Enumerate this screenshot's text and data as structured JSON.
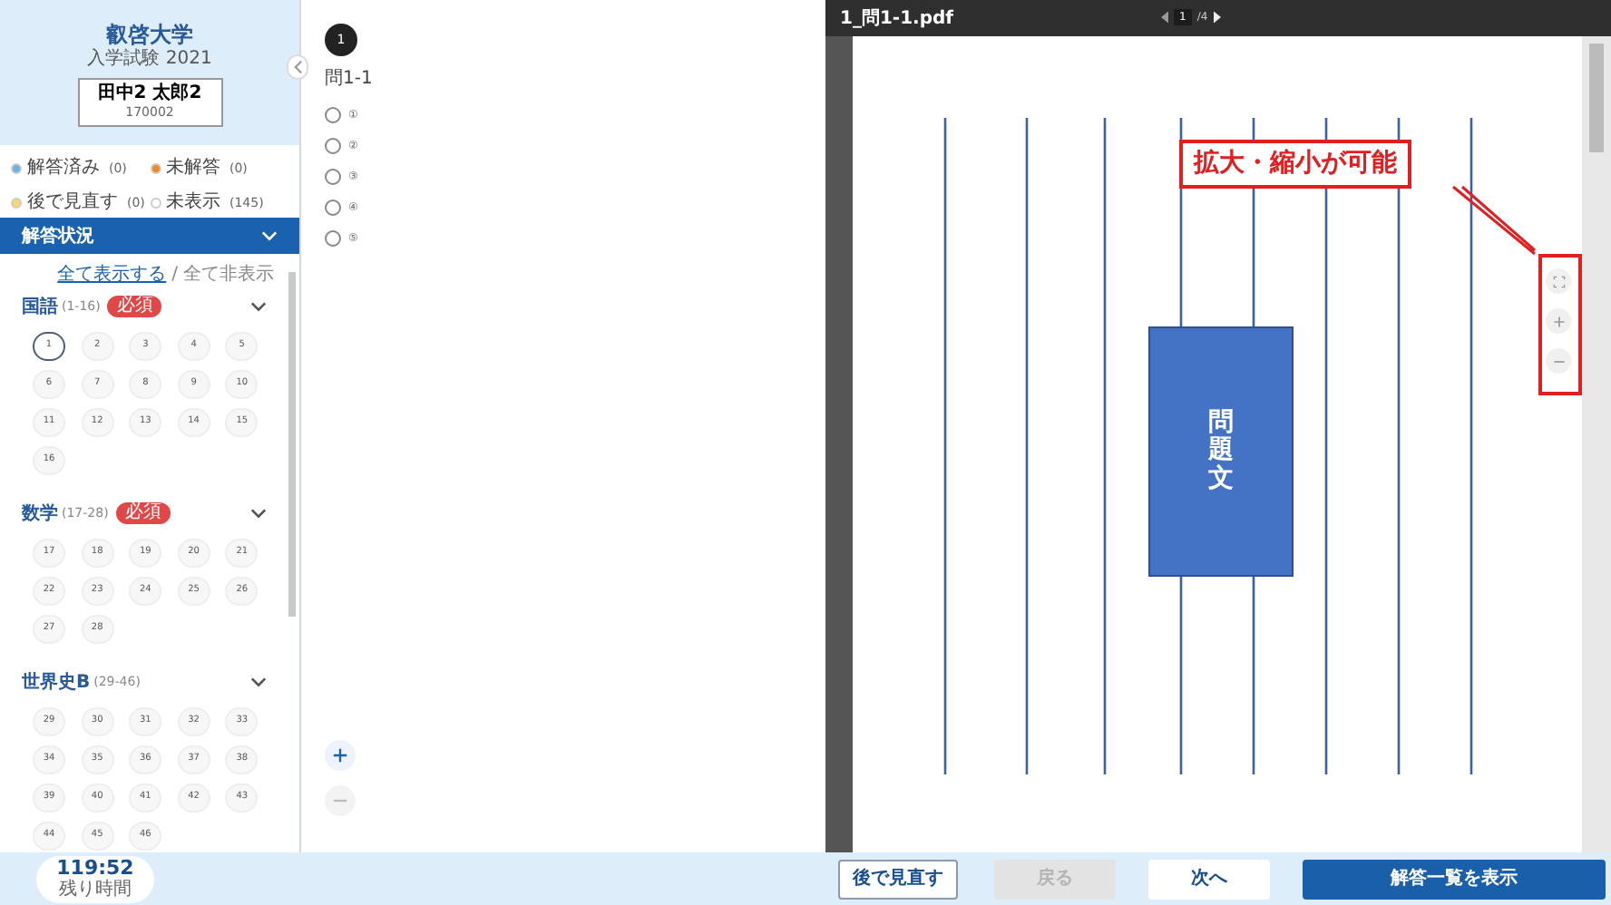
{
  "sidebar": {
    "university": "叡啓大学",
    "exam": "入学試験 2021",
    "examinee": {
      "name": "田中2 太郎2",
      "id": "170002"
    },
    "legend": [
      {
        "label": "解答済み",
        "count": "(0)",
        "color": "#6fb3e0"
      },
      {
        "label": "未解答",
        "count": "(0)",
        "color": "#f08a24"
      },
      {
        "label": "後で見直す",
        "count": "(0)",
        "color": "#f5d76e"
      },
      {
        "label": "未表示",
        "count": "(145)",
        "color": "#ffffff"
      }
    ],
    "status_header": "解答状況",
    "show_all_link": "全て表示する",
    "separator": "/",
    "hide_all_link": "全て非表示",
    "sections": [
      {
        "title": "国語",
        "range": "(1-16)",
        "badge": "必須",
        "questions": [
          {
            "label": "1",
            "selected": true
          },
          {
            "label": "2",
            "selected": false
          },
          {
            "label": "3",
            "selected": false
          },
          {
            "label": "4",
            "selected": false
          },
          {
            "label": "5",
            "selected": false
          },
          {
            "label": "6",
            "selected": false
          },
          {
            "label": "7",
            "selected": false
          },
          {
            "label": "8",
            "selected": false
          },
          {
            "label": "9",
            "selected": false
          },
          {
            "label": "10",
            "selected": false
          },
          {
            "label": "11",
            "selected": false
          },
          {
            "label": "12",
            "selected": false
          },
          {
            "label": "13",
            "selected": false
          },
          {
            "label": "14",
            "selected": false
          },
          {
            "label": "15",
            "selected": false
          },
          {
            "label": "16",
            "selected": false
          }
        ]
      },
      {
        "title": "数学",
        "range": "(17-28)",
        "badge": "必須",
        "questions": [
          {
            "label": "17",
            "selected": false
          },
          {
            "label": "18",
            "selected": false
          },
          {
            "label": "19",
            "selected": false
          },
          {
            "label": "20",
            "selected": false
          },
          {
            "label": "21",
            "selected": false
          },
          {
            "label": "22",
            "selected": false
          },
          {
            "label": "23",
            "selected": false
          },
          {
            "label": "24",
            "selected": false
          },
          {
            "label": "25",
            "selected": false
          },
          {
            "label": "26",
            "selected": false
          },
          {
            "label": "27",
            "selected": false
          },
          {
            "label": "28",
            "selected": false
          }
        ]
      },
      {
        "title": "世界史B",
        "range": "(29-46)",
        "questions": [
          {
            "label": "29",
            "selected": false
          },
          {
            "label": "30",
            "selected": false
          },
          {
            "label": "31",
            "selected": false
          },
          {
            "label": "32",
            "selected": false
          },
          {
            "label": "33",
            "selected": false
          },
          {
            "label": "34",
            "selected": false
          },
          {
            "label": "35",
            "selected": false
          },
          {
            "label": "36",
            "selected": false
          },
          {
            "label": "37",
            "selected": false
          },
          {
            "label": "38",
            "selected": false
          },
          {
            "label": "39",
            "selected": false
          },
          {
            "label": "40",
            "selected": false
          },
          {
            "label": "41",
            "selected": false
          },
          {
            "label": "42",
            "selected": false
          },
          {
            "label": "43",
            "selected": false
          },
          {
            "label": "44",
            "selected": false
          },
          {
            "label": "45",
            "selected": false
          },
          {
            "label": "46",
            "selected": false
          }
        ]
      }
    ]
  },
  "question": {
    "number": "1",
    "label": "問1-1",
    "options": [
      {
        "label": "①",
        "selected": false
      },
      {
        "label": "②",
        "selected": false
      },
      {
        "label": "③",
        "selected": false
      },
      {
        "label": "④",
        "selected": false
      },
      {
        "label": "⑤",
        "selected": false
      }
    ]
  },
  "pdf_viewer": {
    "file_name": "1_問1-1.pdf",
    "page": "1",
    "page_total": "/4",
    "block_text": "問題文",
    "annotation": "拡大・縮小が可能"
  },
  "timer": {
    "time": "119:52",
    "label": "残り時間"
  },
  "buttons": [
    {
      "label": "後で見直す",
      "kind": "outline",
      "disabled": false
    },
    {
      "label": "戻る",
      "kind": "outline",
      "disabled": true
    },
    {
      "label": "次へ",
      "kind": "plain",
      "disabled": false
    },
    {
      "label": "解答一覧を表示",
      "kind": "primary",
      "disabled": false
    }
  ]
}
